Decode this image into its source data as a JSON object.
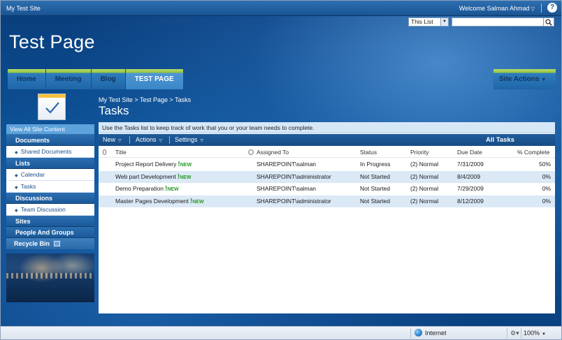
{
  "topbar": {
    "site_link": "My Test Site",
    "welcome": "Welcome Salman Ahmad"
  },
  "search": {
    "scope": "This List",
    "query": ""
  },
  "header": {
    "site_title": "Test Page"
  },
  "nav": {
    "tabs": [
      "Home",
      "Meeting",
      "Blog",
      "TEST PAGE"
    ],
    "active_tab": "TEST PAGE",
    "site_actions": "Site Actions"
  },
  "page": {
    "breadcrumb": "My Test Site > Test Page > Tasks",
    "title": "Tasks"
  },
  "quicklaunch": {
    "view_all": "View All Site Content",
    "documents": "Documents",
    "shared_documents": "Shared Documents",
    "lists": "Lists",
    "calendar": "Calendar",
    "tasks": "Tasks",
    "discussions": "Discussions",
    "team_discussion": "Team Discussion",
    "sites": "Sites",
    "people_and_groups": "People And Groups",
    "recycle_bin": "Recycle Bin"
  },
  "list": {
    "description": "Use the Tasks list to keep track of work that you or your team needs to complete.",
    "toolbar": {
      "new": "New",
      "actions": "Actions",
      "settings": "Settings",
      "view": "All Tasks"
    },
    "columns": {
      "title": "Title",
      "assigned_to": "Assigned To",
      "status": "Status",
      "priority": "Priority",
      "due_date": "Due Date",
      "percent_complete": "% Complete"
    },
    "new_label": "NEW",
    "rows": [
      {
        "title": "Project Report Delivery",
        "assigned_to": "SHAREPOINT\\salman",
        "status": "In Progress",
        "priority": "(2) Normal",
        "due_date": "7/31/2009",
        "percent_complete": "50%"
      },
      {
        "title": "Web part Development",
        "assigned_to": "SHAREPOINT\\administrator",
        "status": "Not Started",
        "priority": "(2) Normal",
        "due_date": "8/4/2009",
        "percent_complete": "0%"
      },
      {
        "title": "Demo Preparation",
        "assigned_to": "SHAREPOINT\\salman",
        "status": "Not Started",
        "priority": "(2) Normal",
        "due_date": "7/29/2009",
        "percent_complete": "0%"
      },
      {
        "title": "Master Pages Development",
        "assigned_to": "SHAREPOINT\\administrator",
        "status": "Not Started",
        "priority": "(2) Normal",
        "due_date": "8/12/2009",
        "percent_complete": "0%"
      }
    ]
  },
  "statusbar": {
    "zone": "Internet",
    "zoom": "100%"
  },
  "colors": {
    "banner": "#0b4a8c",
    "nav_green": "#8fc23f",
    "toolbar": "#1e5c9b",
    "row_alt": "#dbe8f6",
    "new_badge": "#2b9a2b"
  },
  "icons": {
    "help": "help-icon",
    "search": "search-icon",
    "tasks_page": "tasks-checkmark-icon",
    "zone": "globe-icon"
  }
}
